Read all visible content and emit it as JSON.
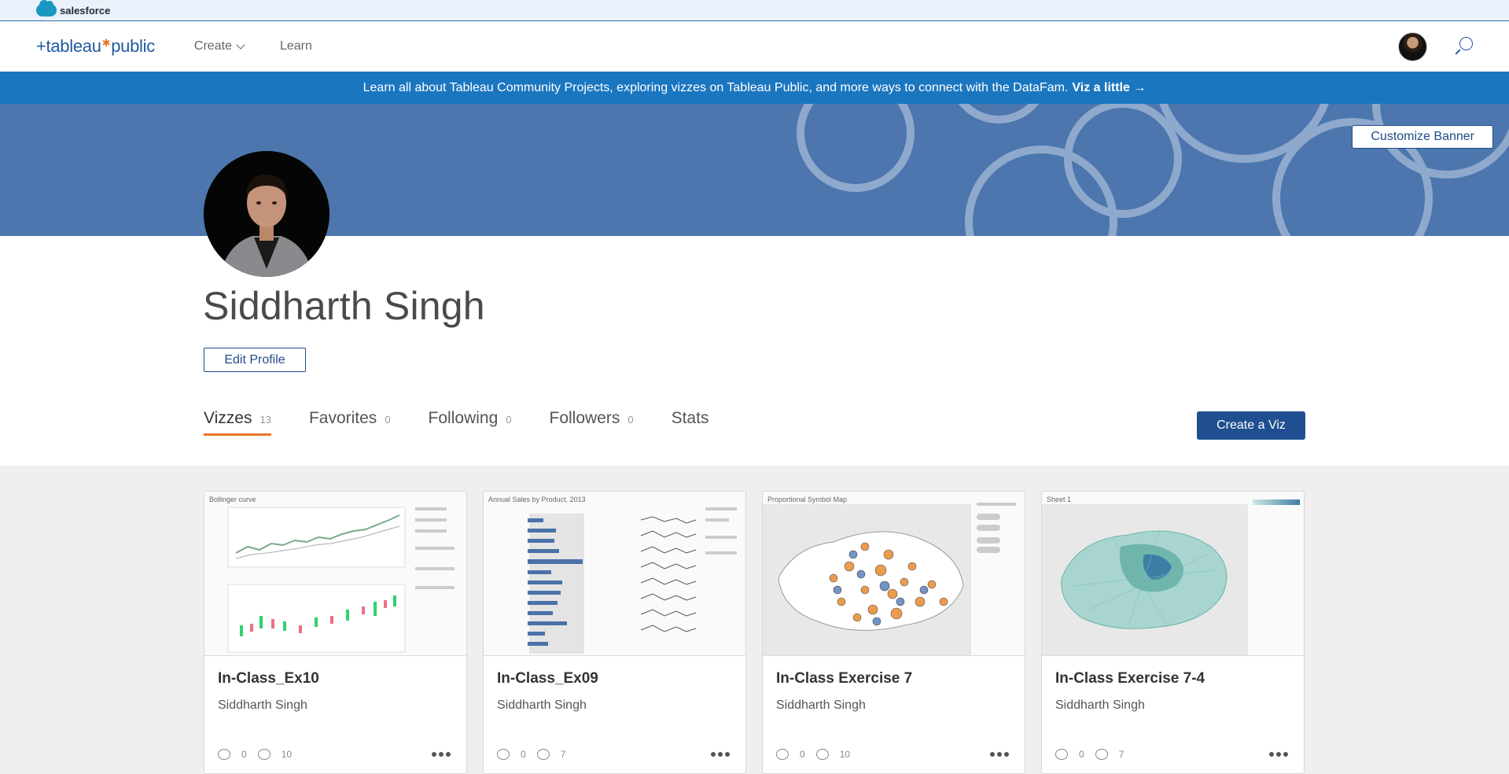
{
  "salesforce": {
    "brand": "salesforce"
  },
  "nav": {
    "logo_left": "+tableau",
    "logo_right": "public",
    "create": "Create",
    "learn": "Learn"
  },
  "announcement": {
    "text": "Learn all about Tableau Community Projects, exploring vizzes on Tableau Public, and more ways to connect with the DataFam.",
    "link": "Viz a little →"
  },
  "banner": {
    "customize": "Customize Banner",
    "color": "#4c76ad"
  },
  "profile": {
    "name": "Siddharth Singh",
    "edit": "Edit Profile",
    "create_viz": "Create a Viz"
  },
  "tabs": [
    {
      "label": "Vizzes",
      "count": "13"
    },
    {
      "label": "Favorites",
      "count": "0"
    },
    {
      "label": "Following",
      "count": "0"
    },
    {
      "label": "Followers",
      "count": "0"
    },
    {
      "label": "Stats",
      "count": ""
    }
  ],
  "cards": [
    {
      "title": "In-Class_Ex10",
      "author": "Siddharth Singh",
      "thumb_label": "Bollinger curve",
      "favorites": "0",
      "views": "10"
    },
    {
      "title": "In-Class_Ex09",
      "author": "Siddharth Singh",
      "thumb_label": "Annual Sales by Product, 2013",
      "favorites": "0",
      "views": "7"
    },
    {
      "title": "In-Class Exercise 7",
      "author": "Siddharth Singh",
      "thumb_label": "Proportional Symbol Map",
      "favorites": "0",
      "views": "10"
    },
    {
      "title": "In-Class Exercise 7-4",
      "author": "Siddharth Singh",
      "thumb_label": "Sheet 1",
      "favorites": "0",
      "views": "7"
    }
  ],
  "colors": {
    "accent": "#e97627",
    "primary": "#1f4f91",
    "announce": "#1b76c0"
  }
}
